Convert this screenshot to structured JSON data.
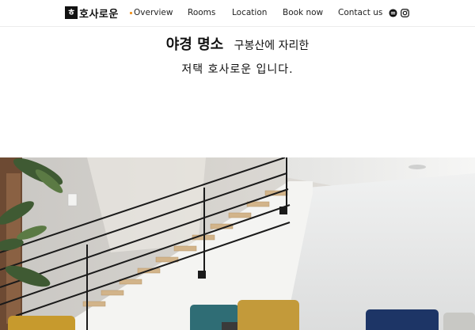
{
  "brand": {
    "logo_char": "ㅎ",
    "name": "호사로운"
  },
  "nav": {
    "items": [
      {
        "label": "Overview",
        "active": true
      },
      {
        "label": "Rooms"
      },
      {
        "label": "Location"
      },
      {
        "label": "Book now"
      },
      {
        "label": "Contact us"
      }
    ],
    "accent_color": "#f29a2e"
  },
  "hero": {
    "highlight": "야경 명소",
    "line1_rest": "구봉산에 자리한",
    "line2": "저택 호사로운 입니다."
  },
  "social": [
    "blog-icon",
    "instagram-icon"
  ]
}
